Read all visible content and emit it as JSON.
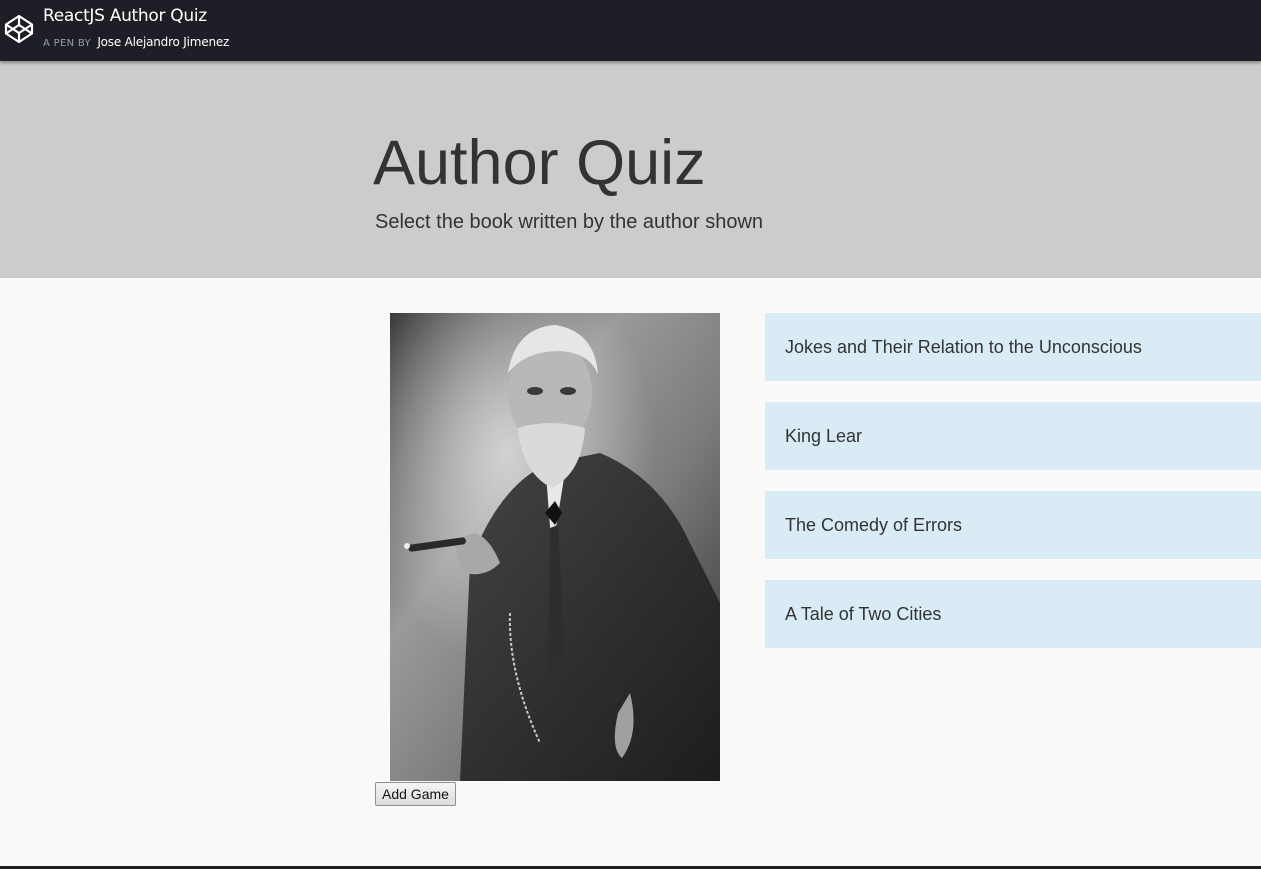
{
  "header": {
    "pen_title": "ReactJS Author Quiz",
    "by_label": "A PEN BY",
    "author_name": "Jose Alejandro Jimenez",
    "logo_icon": "codepen-cube-icon"
  },
  "jumbotron": {
    "title": "Author Quiz",
    "subtitle": "Select the book written by the author shown"
  },
  "turn": {
    "author_image_alt": "Author portrait",
    "books": [
      "Jokes and Their Relation to the Unconscious",
      "King Lear",
      "The Comedy of Errors",
      "A Tale of Two Cities"
    ]
  },
  "actions": {
    "add_game_label": "Add Game"
  },
  "colors": {
    "header_bg": "#1e1f26",
    "jumbotron_bg": "#cccccc",
    "answer_bg": "#d9ecf5",
    "page_bg": "#f9f9f9"
  }
}
